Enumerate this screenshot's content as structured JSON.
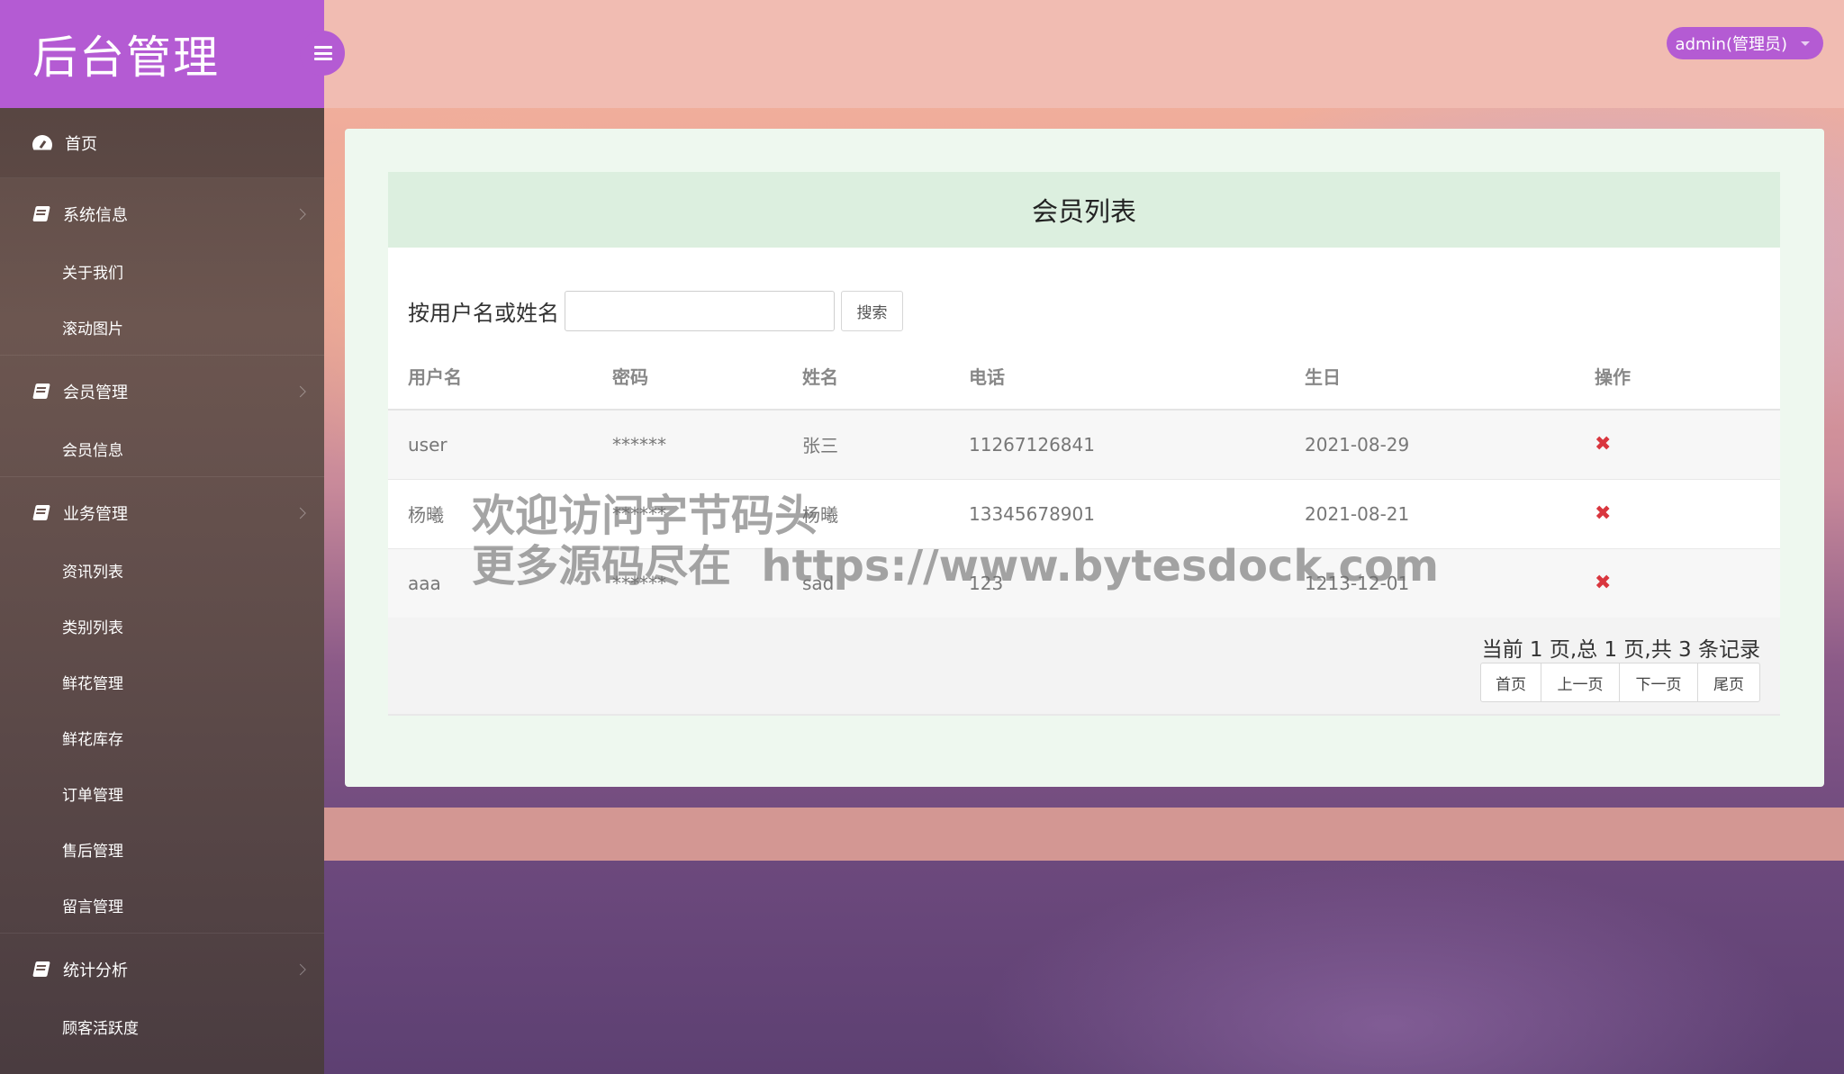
{
  "sidebar": {
    "logo": "后台管理",
    "home": "首页",
    "groups": [
      {
        "title": "系统信息",
        "items": [
          "关于我们",
          "滚动图片"
        ]
      },
      {
        "title": "会员管理",
        "items": [
          "会员信息"
        ]
      },
      {
        "title": "业务管理",
        "items": [
          "资讯列表",
          "类别列表",
          "鲜花管理",
          "鲜花库存",
          "订单管理",
          "售后管理",
          "留言管理"
        ]
      },
      {
        "title": "统计分析",
        "items": [
          "顾客活跃度"
        ]
      }
    ]
  },
  "header": {
    "user": "admin(管理员)"
  },
  "panel": {
    "title": "会员列表",
    "search_label": "按用户名或姓名",
    "search_value": "",
    "search_button": "搜索"
  },
  "table": {
    "columns": [
      "用户名",
      "密码",
      "姓名",
      "电话",
      "生日",
      "操作"
    ],
    "rows": [
      {
        "username": "user",
        "password": "******",
        "name": "张三",
        "phone": "11267126841",
        "birthday": "2021-08-29",
        "action": "✖"
      },
      {
        "username": "杨曦",
        "password": "******",
        "name": "杨曦",
        "phone": "13345678901",
        "birthday": "2021-08-21",
        "action": "✖"
      },
      {
        "username": "aaa",
        "password": "******",
        "name": "sad",
        "phone": "123",
        "birthday": "1213-12-01",
        "action": "✖"
      }
    ]
  },
  "pager": {
    "info": "当前 1 页,总 1 页,共 3 条记录",
    "first": "首页",
    "prev": "上一页",
    "next": "下一页",
    "last": "尾页"
  },
  "watermark": {
    "line1": "欢迎访问字节码头",
    "line2": "更多源码尽在  https://www.bytesdock.com"
  },
  "colors": {
    "accent": "#b45bd3",
    "panel_head": "#dcefdf",
    "delete": "#d9363e"
  }
}
